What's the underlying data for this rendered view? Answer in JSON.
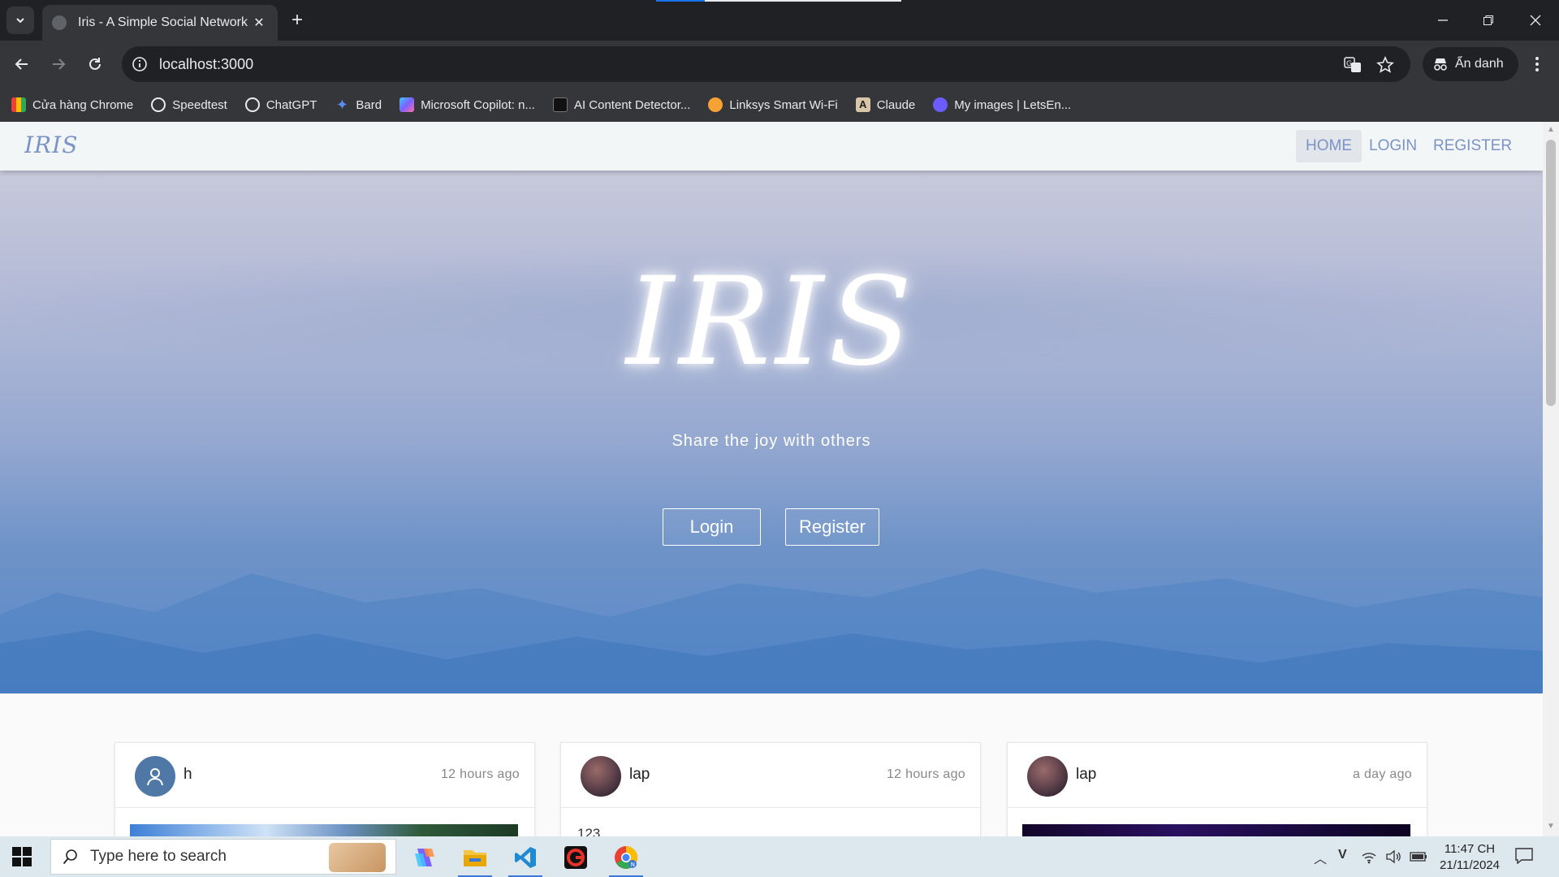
{
  "browser": {
    "tab_title": "Iris - A Simple Social Network",
    "tab_close": "✕",
    "new_tab": "+",
    "url": "localhost:3000",
    "incognito_label": "Ẩn danh",
    "bookmarks": [
      {
        "label": "Cửa hàng Chrome",
        "color": "#e94235"
      },
      {
        "label": "Speedtest",
        "color": "#e8eaed"
      },
      {
        "label": "ChatGPT",
        "color": "#e8eaed"
      },
      {
        "label": "Bard",
        "color": "#5b8def"
      },
      {
        "label": "Microsoft Copilot: n...",
        "color": "#7b61ff"
      },
      {
        "label": "AI Content Detector...",
        "color": "#111111"
      },
      {
        "label": "Linksys Smart Wi-Fi",
        "color": "#f4a233"
      },
      {
        "label": "Claude",
        "color": "#d97757"
      },
      {
        "label": "My images | LetsEn...",
        "color": "#6a5cff"
      }
    ]
  },
  "site": {
    "brand": "IRIS",
    "nav": {
      "home": "HOME",
      "login": "LOGIN",
      "register": "REGISTER"
    },
    "hero": {
      "title": "IRIS",
      "subtitle": "Share the joy with others",
      "login_button": "Login",
      "register_button": "Register"
    },
    "posts": [
      {
        "username": "h",
        "time": "12 hours ago",
        "avatar": "user-icon"
      },
      {
        "username": "lap",
        "time": "12 hours ago",
        "avatar": "photo",
        "text": "123"
      },
      {
        "username": "lap",
        "time": "a day ago",
        "avatar": "photo"
      }
    ],
    "colors": {
      "accent": "#7b93c6",
      "navbar_bg": "#f3f6f7"
    }
  },
  "taskbar": {
    "search_placeholder": "Type here to search",
    "time": "11:47 CH",
    "date": "21/11/2024",
    "apps": [
      "copilot-icon",
      "file-explorer-icon",
      "vscode-icon",
      "garena-icon",
      "chrome-icon"
    ]
  }
}
